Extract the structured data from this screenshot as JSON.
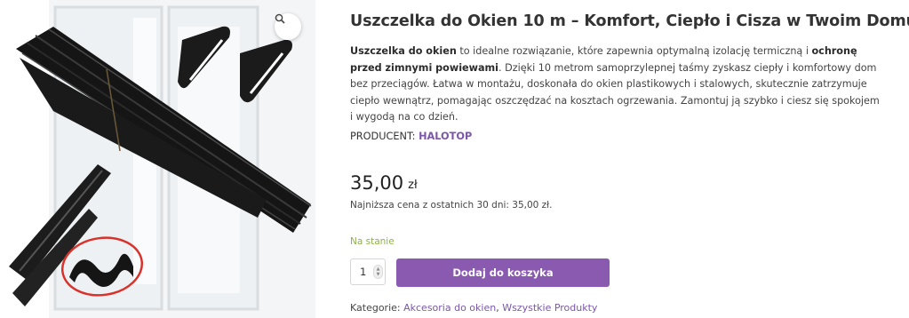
{
  "gallery": {
    "image_alt": "product-photo-window-seal",
    "zoom_icon": "magnifier-icon"
  },
  "product": {
    "title": "Uszczelka do Okien 10 m – Komfort, Ciepło i Cisza w Twoim Domu!",
    "description": {
      "part1_bold": "Uszczelka do okien",
      "part2": " to idealne rozwiązanie, które zapewnia optymalną izolację termiczną i ",
      "part3_bold": "ochronę przed zimnymi powiewami",
      "part4": ". Dzięki 10 metrom samoprzylepnej taśmy zyskasz ciepły i komfortowy dom bez przeciągów. Łatwa w montażu, doskonała do okien plastikowych i stalowych, skutecznie zatrzymuje ciepło wewnątrz, pomagając oszczędzać na kosztach ogrzewania. Zamontuj ją szybko i ciesz się spokojem i wygodą na co dzień."
    },
    "producer_label": "PRODUCENT:",
    "producer_name": "HALOTOP",
    "price_value": "35,00",
    "price_currency": "zł",
    "lowest_price_text": "Najniższa cena z ostatnich 30 dni: 35,00 zł.",
    "stock_status": "Na stanie",
    "quantity": "1",
    "add_to_cart_label": "Dodaj do koszyka",
    "categories_label": "Kategorie:",
    "categories": [
      "Akcesoria do okien",
      "Wszystkie Produkty"
    ],
    "categories_separator": ", "
  },
  "colors": {
    "accent": "#8a5ab0",
    "link": "#7a57a8",
    "in_stock": "#8fb14e"
  }
}
